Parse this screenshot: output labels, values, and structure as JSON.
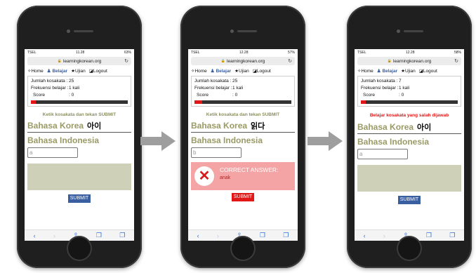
{
  "phones": [
    {
      "status": {
        "carrier": "TSEL",
        "time": "11.28",
        "battery": "63%"
      },
      "url": "learningkorean.org",
      "nav": [
        "Home",
        "Belajar",
        "Ujian",
        "Logout"
      ],
      "stats": {
        "jumlah_label": "Jumlah kosakata :",
        "jumlah": "25",
        "frek_label": "Frekuensi belajar :",
        "frek": "1 kali",
        "score_label": "Score",
        "score": ": 0"
      },
      "progress": 0.05,
      "instruction": "Ketik kosakata dan tekan SUBMIT",
      "korea_label": "Bahasa Korea",
      "korea_word": "아이",
      "indo_label": "Bahasa Indonesia",
      "answer": "a",
      "submit": "SUBMIT"
    },
    {
      "status": {
        "carrier": "TSEL",
        "time": "12.28",
        "battery": "57%"
      },
      "url": "learningkorean.org",
      "nav": [
        "Home",
        "Belajar",
        "Ujian",
        "Logout"
      ],
      "stats": {
        "jumlah_label": "Jumlah kosakata :",
        "jumlah": "25",
        "frek_label": "Frekuensi belajar :",
        "frek": "1 kali",
        "score_label": "Score",
        "score": ": 0"
      },
      "progress": 0.08,
      "instruction": "Ketik kosakata dan tekan SUBMIT",
      "korea_label": "Bahasa Korea",
      "korea_word": "읽다",
      "indo_label": "Bahasa Indonesia",
      "answer": "b",
      "correct_title": "CORRECT ANSWER:",
      "correct_answer": "anak",
      "submit": "SUBMIT"
    },
    {
      "status": {
        "carrier": "TSEL",
        "time": "12.28",
        "battery": "58%"
      },
      "url": "learningkorean.org",
      "nav": [
        "Home",
        "Belajar",
        "Ujian",
        "Logout"
      ],
      "stats": {
        "jumlah_label": "Jumlah kosakata :",
        "jumlah": "7",
        "frek_label": "Frekuensi belajar :",
        "frek": "1 kali",
        "score_label": "Score",
        "score": ": 0"
      },
      "progress": 0.05,
      "instruction": "Belajar kosakata yang salah dijawab",
      "korea_label": "Bahasa Korea",
      "korea_word": "아이",
      "indo_label": "Bahasa Indonesia",
      "answer": "a",
      "submit": "SUBMIT"
    }
  ],
  "colors": {
    "accent": "#3a5fa0",
    "red": "#e01818",
    "olive": "#9a9a66",
    "feedback": "#cfd0b8",
    "correct_bg": "#f4a4a4"
  }
}
